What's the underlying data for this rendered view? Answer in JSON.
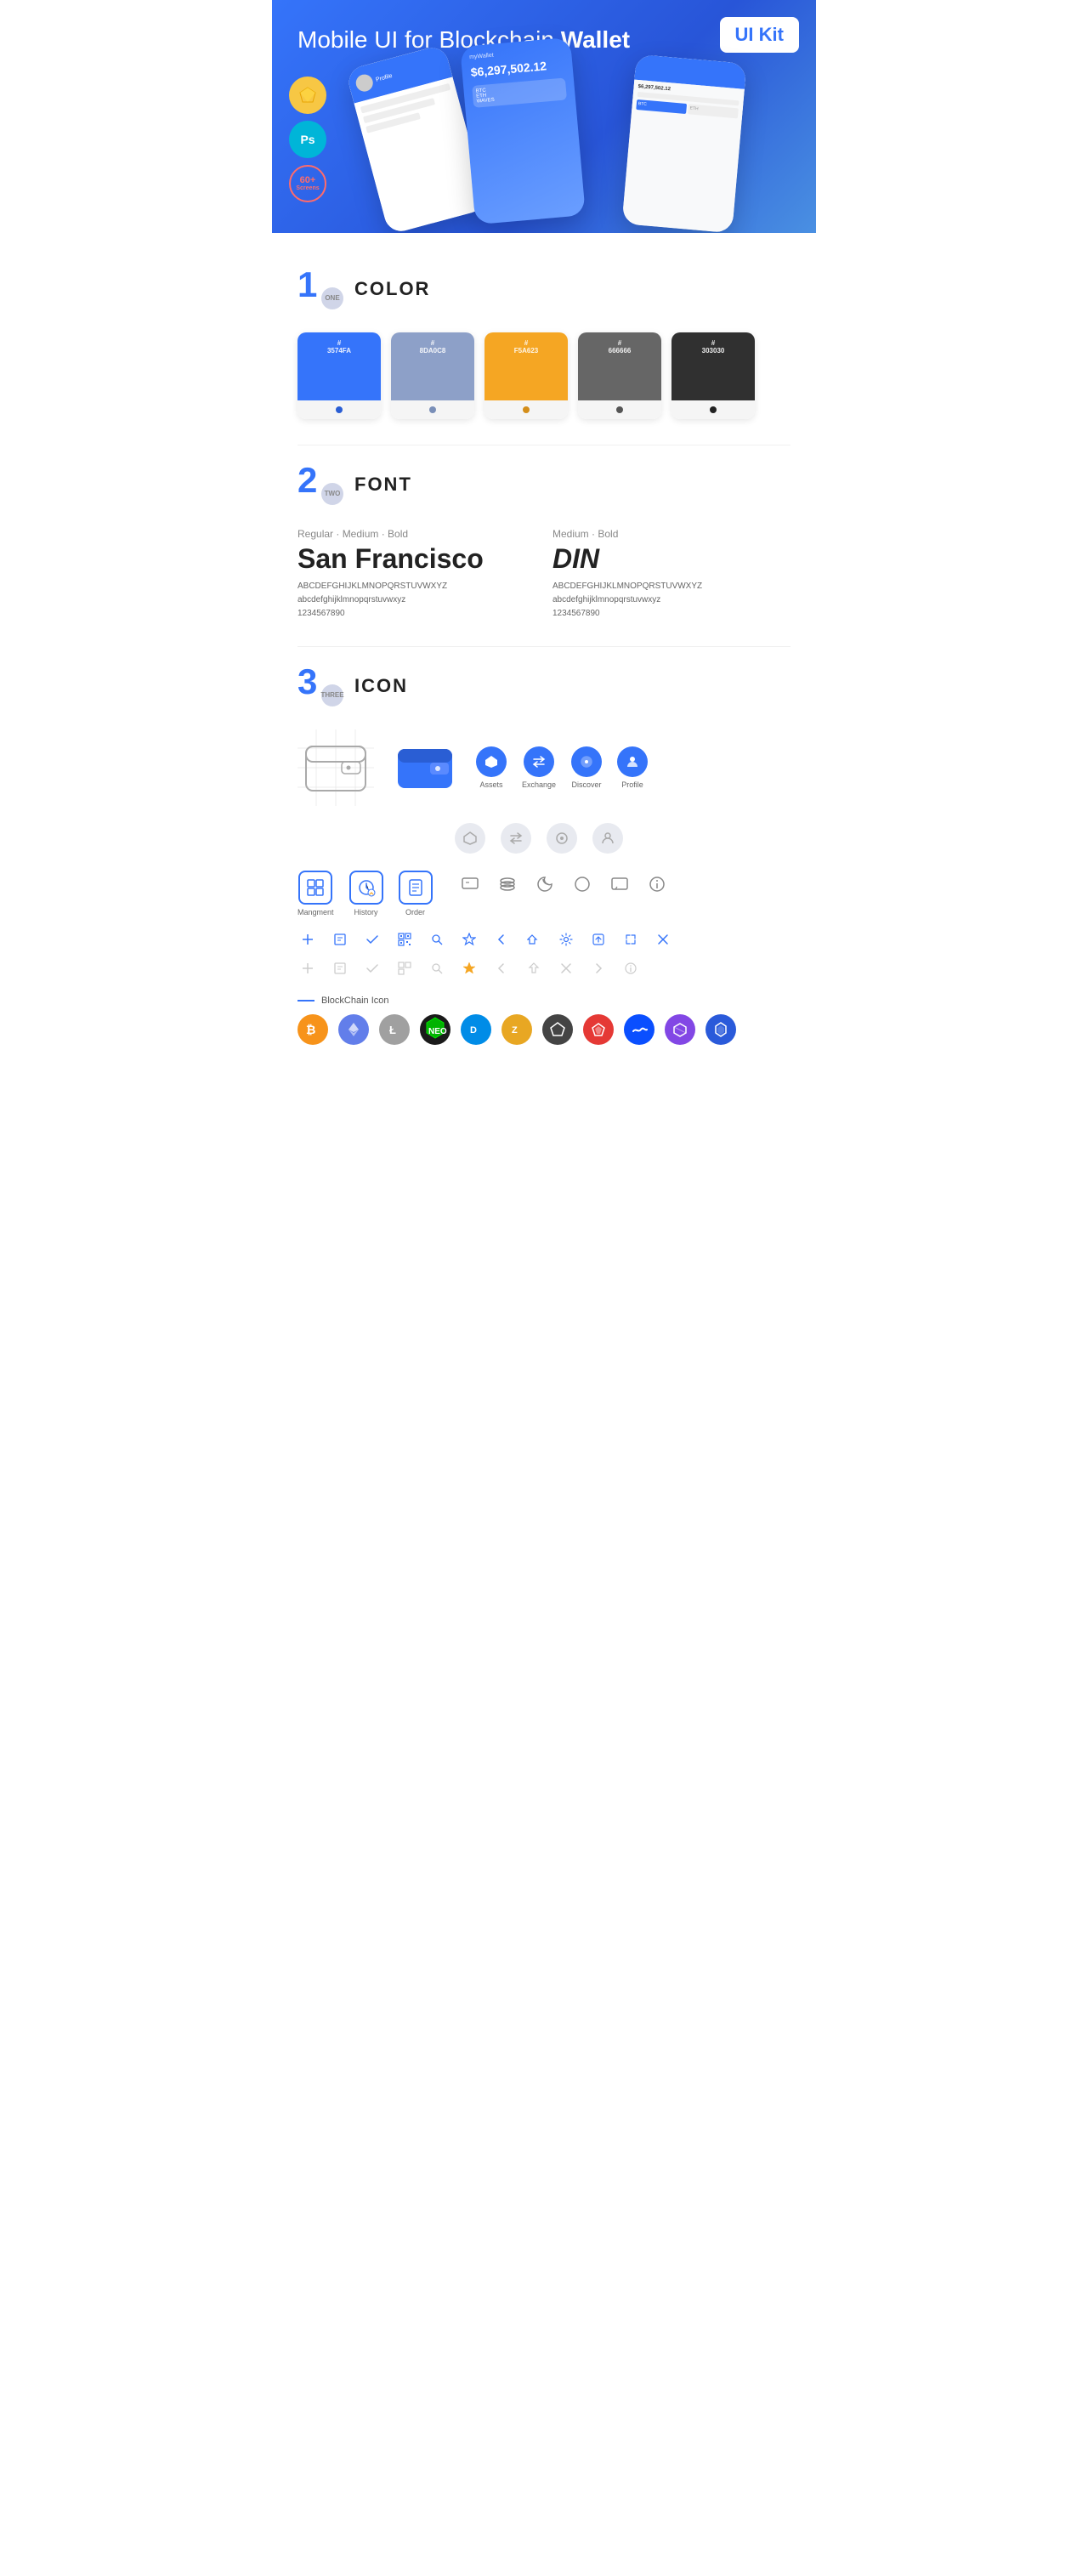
{
  "hero": {
    "title_regular": "Mobile UI for Blockchain ",
    "title_bold": "Wallet",
    "badge": "UI Kit",
    "badge_sketch": "S",
    "badge_ps": "Ps",
    "badge_screens": "60+",
    "badge_screens_label": "Screens"
  },
  "sections": {
    "color": {
      "number": "1",
      "number_label": "ONE",
      "title": "COLOR",
      "swatches": [
        {
          "hex": "#3574FA",
          "label": "#\n3574FA",
          "dot": "#2a5ed4"
        },
        {
          "hex": "#8DA0C8",
          "label": "#\n8DA0C8",
          "dot": "#7a8fb8"
        },
        {
          "hex": "#F5A623",
          "label": "#\nF5A623",
          "dot": "#d48e1a"
        },
        {
          "hex": "#666666",
          "label": "#\n666666",
          "dot": "#555555"
        },
        {
          "hex": "#303030",
          "label": "#\n303030",
          "dot": "#222222"
        }
      ]
    },
    "font": {
      "number": "2",
      "number_label": "TWO",
      "title": "FONT",
      "fonts": [
        {
          "style_label": "Regular · Medium · Bold",
          "name": "San Francisco",
          "uppercase": "ABCDEFGHIJKLMNOPQRSTUVWXYZ",
          "lowercase": "abcdefghijklmnopqrstuvwxyz",
          "numbers": "1234567890"
        },
        {
          "style_label": "Medium · Bold",
          "name": "DIN",
          "uppercase": "ABCDEFGHIJKLMNOPQRSTUVWXYZ",
          "lowercase": "abcdefghijklmnopqrstuvwxyz",
          "numbers": "1234567890"
        }
      ]
    },
    "icon": {
      "number": "3",
      "number_label": "THREE",
      "title": "ICON",
      "nav_icons": [
        {
          "label": "Assets",
          "symbol": "◆"
        },
        {
          "label": "Exchange",
          "symbol": "⇄"
        },
        {
          "label": "Discover",
          "symbol": "●"
        },
        {
          "label": "Profile",
          "symbol": "👤"
        }
      ],
      "app_icons": [
        {
          "label": "Mangment",
          "symbol": "▣"
        },
        {
          "label": "History",
          "symbol": "🕐"
        },
        {
          "label": "Order",
          "symbol": "📋"
        }
      ],
      "misc_symbols_active": [
        "≡",
        "☰",
        "◑",
        "●",
        "💬",
        "ℹ"
      ],
      "small_icons_active": [
        "+",
        "📋",
        "✓",
        "⊞",
        "🔍",
        "☆",
        "<",
        "⇤",
        "⚙",
        "⬒",
        "↔",
        "✕"
      ],
      "small_icons_ghost": [
        "+",
        "📋",
        "✓",
        "⊞",
        "↩",
        "☆",
        "<",
        "↔",
        "✕",
        "→",
        "ℹ"
      ],
      "blockchain_label": "BlockChain Icon",
      "crypto": [
        {
          "symbol": "₿",
          "class": "crypto-btc"
        },
        {
          "symbol": "Ξ",
          "class": "crypto-eth"
        },
        {
          "symbol": "Ł",
          "class": "crypto-ltc"
        },
        {
          "symbol": "N",
          "class": "crypto-neo"
        },
        {
          "symbol": "D",
          "class": "crypto-dash"
        },
        {
          "symbol": "Z",
          "class": "crypto-zcash"
        },
        {
          "symbol": "◈",
          "class": "crypto-iota"
        },
        {
          "symbol": "A",
          "class": "crypto-ark"
        },
        {
          "symbol": "W",
          "class": "crypto-waves"
        },
        {
          "symbol": "M",
          "class": "crypto-matic"
        },
        {
          "symbol": "⬡",
          "class": "crypto-link"
        }
      ]
    }
  }
}
